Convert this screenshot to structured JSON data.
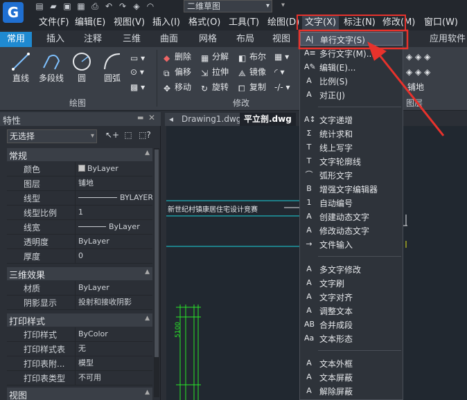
{
  "app": {
    "workspace": "二维草图",
    "logo": "G"
  },
  "menu": {
    "items": [
      {
        "label": "文件(F)"
      },
      {
        "label": "编辑(E)"
      },
      {
        "label": "视图(V)"
      },
      {
        "label": "插入(I)"
      },
      {
        "label": "格式(O)"
      },
      {
        "label": "工具(T)"
      },
      {
        "label": "绘图(D)"
      },
      {
        "label": "文字(X)"
      },
      {
        "label": "标注(N)"
      },
      {
        "label": "修改(M)"
      },
      {
        "label": "窗口(W)"
      }
    ]
  },
  "tabs": [
    "常用",
    "插入",
    "注释",
    "三维",
    "曲面",
    "网格",
    "布局",
    "视图",
    "应用软件"
  ],
  "ribbon": {
    "draw": {
      "title": "绘图",
      "line": "直线",
      "polyline": "多段线",
      "circle": "圆",
      "arc": "圆弧"
    },
    "modify": {
      "title": "修改",
      "erase": "删除",
      "explode": "分解",
      "boolean": "布尔",
      "offset": "偏移",
      "stretch": "拉伸",
      "mirror": "镜像",
      "move": "移动",
      "rotate": "旋转",
      "copy": "复制"
    },
    "layer": {
      "layer_name": "铺地",
      "title": "图层"
    }
  },
  "properties": {
    "title": "特性",
    "selection": "无选择",
    "sections": {
      "general": "常规",
      "three_d": "三维效果",
      "plot": "打印样式",
      "view": "视图"
    },
    "general_rows": [
      {
        "key": "颜色",
        "value": "ByLayer"
      },
      {
        "key": "图层",
        "value": "铺地"
      },
      {
        "key": "线型",
        "value": "BYLAYER"
      },
      {
        "key": "线型比例",
        "value": "1"
      },
      {
        "key": "线宽",
        "value": "ByLayer"
      },
      {
        "key": "透明度",
        "value": "ByLayer"
      },
      {
        "key": "厚度",
        "value": "0"
      }
    ],
    "three_d_rows": [
      {
        "key": "材质",
        "value": "ByLayer"
      },
      {
        "key": "阴影显示",
        "value": "投射和接收阴影"
      }
    ],
    "plot_rows": [
      {
        "key": "打印样式",
        "value": "ByColor"
      },
      {
        "key": "打印样式表",
        "value": "无"
      },
      {
        "key": "打印表附...",
        "value": "模型"
      },
      {
        "key": "打印表类型",
        "value": "不可用"
      }
    ]
  },
  "documents": {
    "tab1": "Drawing1.dwg",
    "tab2": "平立剖.dwg"
  },
  "canvas": {
    "title_text": "新世纪村镇康居住宅设计竞赛",
    "dim_text": "5100"
  },
  "text_menu": {
    "group1": [
      {
        "icon": "A|",
        "label": "单行文字(S)"
      },
      {
        "icon": "A≡",
        "label": "多行文字(M)..."
      },
      {
        "icon": "A✎",
        "label": "编辑(E)..."
      },
      {
        "icon": "A",
        "label": "比例(S)"
      },
      {
        "icon": "A",
        "label": "对正(J)"
      }
    ],
    "group2": [
      {
        "icon": "A↕",
        "label": "文字递增"
      },
      {
        "icon": "Σ",
        "label": "统计求和"
      },
      {
        "icon": "T",
        "label": "线上写字"
      },
      {
        "icon": "T",
        "label": "文字轮廓线"
      },
      {
        "icon": "⌒",
        "label": "弧形文字"
      },
      {
        "icon": "B",
        "label": "增强文字编辑器"
      },
      {
        "icon": "1",
        "label": "自动编号"
      },
      {
        "icon": "A",
        "label": "创建动态文字"
      },
      {
        "icon": "A",
        "label": "修改动态文字"
      },
      {
        "icon": "→",
        "label": "文件输入"
      }
    ],
    "group3": [
      {
        "icon": "A",
        "label": "多文字修改"
      },
      {
        "icon": "A",
        "label": "文字刷"
      },
      {
        "icon": "A",
        "label": "文字对齐"
      },
      {
        "icon": "A",
        "label": "调整文本"
      },
      {
        "icon": "AB",
        "label": "合并成段"
      },
      {
        "icon": "Aa",
        "label": "文本形态"
      }
    ],
    "group4": [
      {
        "icon": "A",
        "label": "文本外框"
      },
      {
        "icon": "A",
        "label": "文本屏蔽"
      },
      {
        "icon": "A",
        "label": "解除屏蔽"
      }
    ]
  },
  "colors": {
    "accent": "#1f8ad1",
    "highlight_red": "#e8322c",
    "line_green": "#29e829",
    "line_cyan": "#1ad6e0"
  }
}
